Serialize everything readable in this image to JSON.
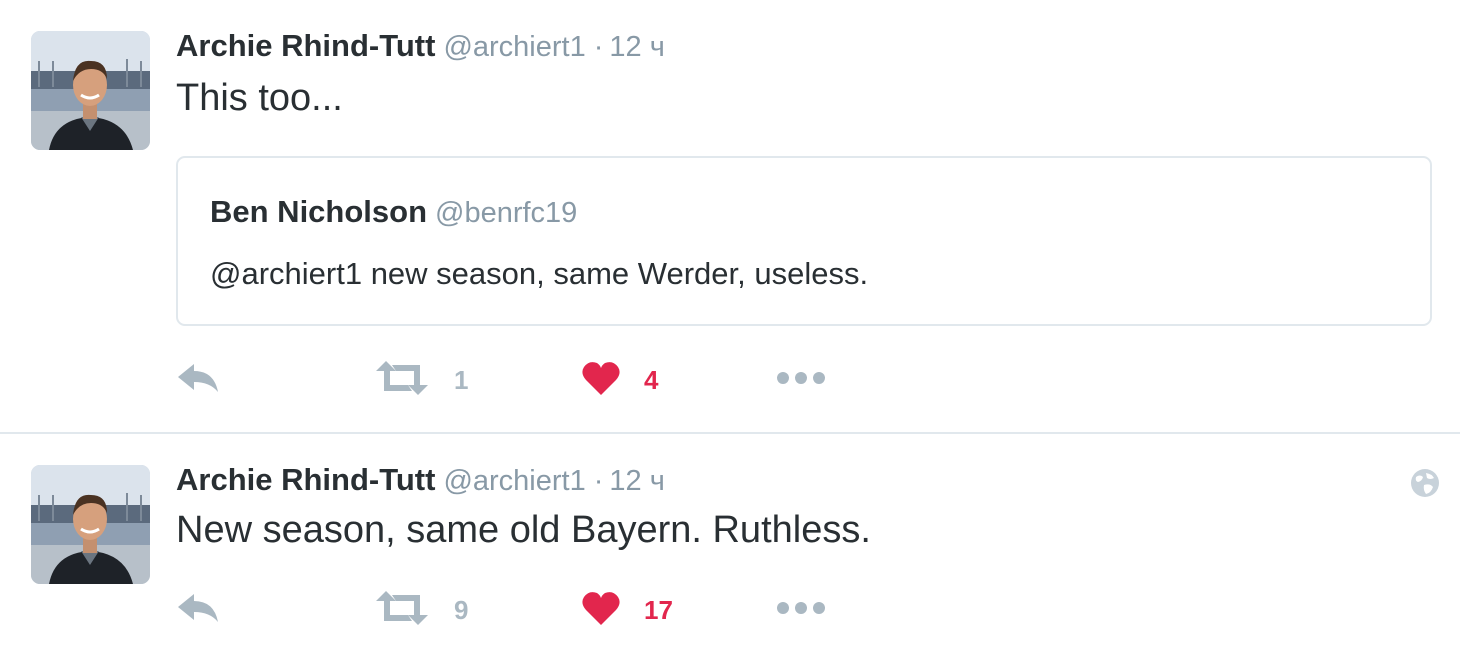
{
  "colors": {
    "text": "#292f33",
    "muted": "#8899a6",
    "icon": "#aab8c2",
    "like": "#e2264d",
    "border": "#e1e8ed"
  },
  "tweets": [
    {
      "fullname": "Archie Rhind-Tutt",
      "username": "@archiert1",
      "separator": "·",
      "time": "12 ч",
      "text": "This too...",
      "quote": {
        "fullname": "Ben Nicholson",
        "username": "@benrfc19",
        "text": "@archiert1 new season, same Werder, useless."
      },
      "retweets": "1",
      "likes": "4",
      "icons": [
        "reply-icon",
        "retweet-icon",
        "heart-icon",
        "more-icon"
      ]
    },
    {
      "fullname": "Archie Rhind-Tutt",
      "username": "@archiert1",
      "separator": "·",
      "time": "12 ч",
      "text": "New season, same old Bayern. Ruthless.",
      "retweets": "9",
      "likes": "17",
      "icons": [
        "reply-icon",
        "retweet-icon",
        "heart-icon",
        "more-icon",
        "globe-icon"
      ]
    }
  ]
}
